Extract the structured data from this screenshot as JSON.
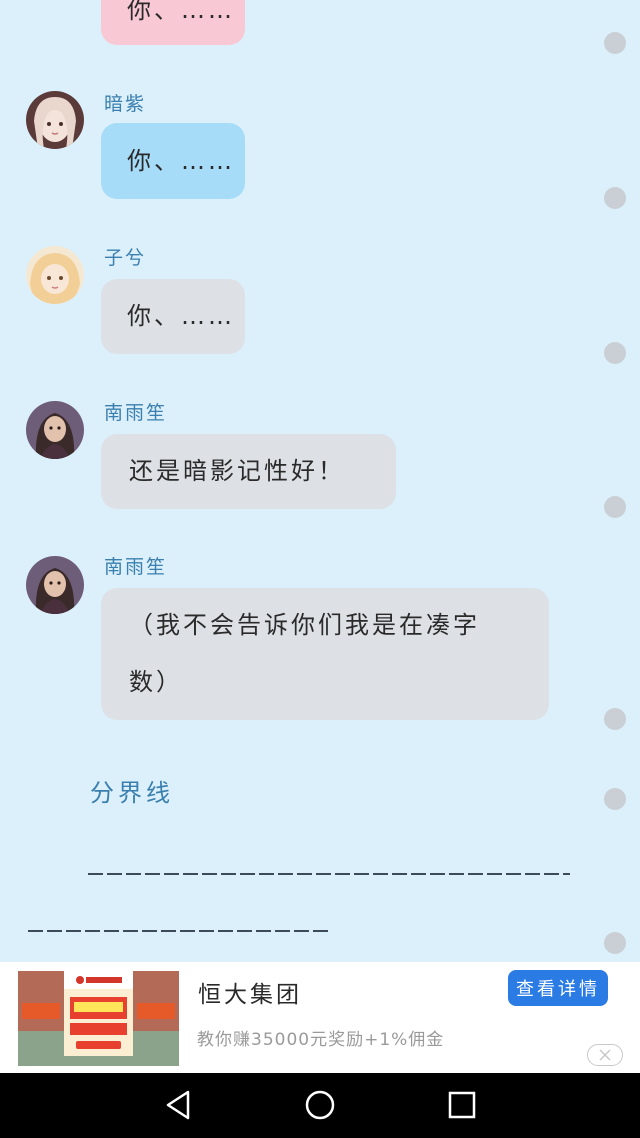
{
  "colors": {
    "background": "#dcf0fb",
    "name_text": "#3a7fae",
    "bubble_pink": "#f8c8d4",
    "bubble_blue": "#a6dcf8",
    "bubble_gray": "#dde1e6",
    "accent_button": "#2b7be5",
    "nav_bar": "#000000"
  },
  "messages": [
    {
      "name": "",
      "text": "你、……",
      "bubble_color": "pink",
      "avatar": ""
    },
    {
      "name": "暗紫",
      "text": "你、……",
      "bubble_color": "blue",
      "avatar": "avatar-girl-doll-pale"
    },
    {
      "name": "子兮",
      "text": "你、……",
      "bubble_color": "gray",
      "avatar": "avatar-girl-doll-blonde"
    },
    {
      "name": "南雨笙",
      "text": "还是暗影记性好！",
      "bubble_color": "gray",
      "avatar": "avatar-woman-dark-hair"
    },
    {
      "name": "南雨笙",
      "text": "（我不会告诉你们我是在凑字数）",
      "bubble_color": "gray",
      "avatar": "avatar-woman-dark-hair"
    }
  ],
  "divider": {
    "label": "分界线"
  },
  "ad": {
    "image_name": "evergrande-ad-image",
    "title": "恒大集团",
    "subtitle": "教你赚35000元奖励+1%佣金",
    "button_label": "查看详情",
    "close_icon": "close-icon"
  },
  "navbar": {
    "back_icon": "back-triangle-icon",
    "home_icon": "home-circle-icon",
    "recents_icon": "recents-square-icon"
  }
}
